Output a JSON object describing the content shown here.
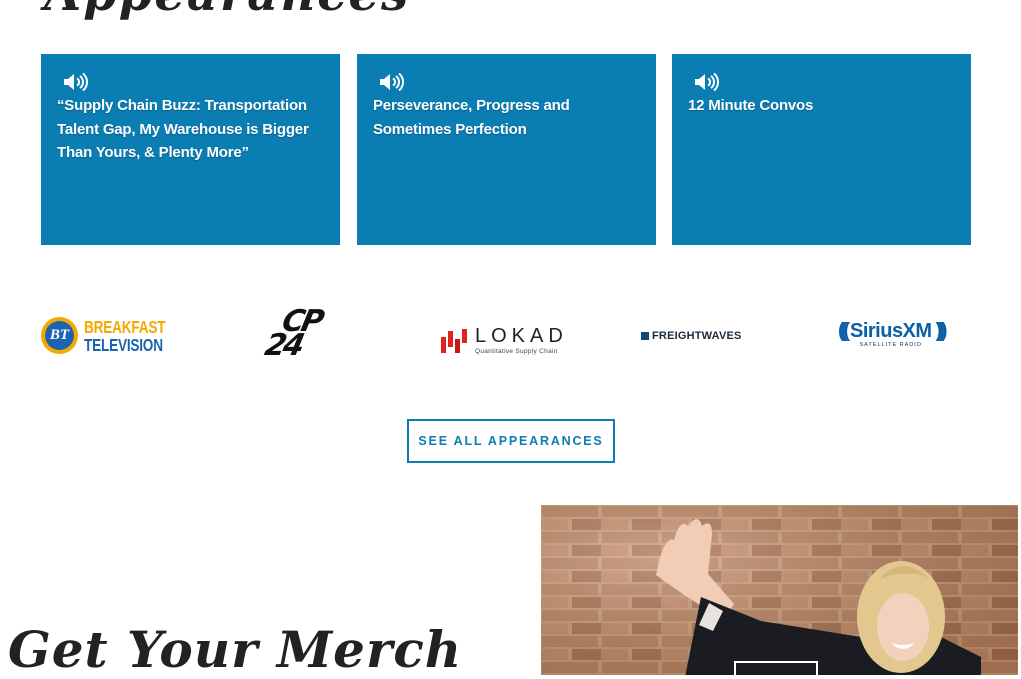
{
  "section": {
    "heading": "Appearances"
  },
  "appearances": [
    {
      "title": "“Supply Chain Buzz: Transportation Talent Gap, My Warehouse is Bigger Than Yours, & Plenty More”"
    },
    {
      "title": "Perseverance, Progress and Sometimes Perfection"
    },
    {
      "title": "12 Minute Convos"
    }
  ],
  "logos": {
    "bt": {
      "badge": "BT",
      "line1": "BREAKFAST",
      "line2": "TELEVISION"
    },
    "cp24": {
      "line1": "CP",
      "line2": "24"
    },
    "lokad": {
      "name": "LOKAD",
      "tagline": "Quantitative Supply Chain"
    },
    "freightwaves": {
      "name": "FREIGHTWAVES"
    },
    "siriusxm": {
      "name": "SiriusXM",
      "tagline": "SATELLITE RADIO"
    }
  },
  "cta": {
    "see_all_label": "SEE ALL APPEARANCES"
  },
  "merch": {
    "heading": "Get Your Merch"
  },
  "colors": {
    "accent": "#0a7db3",
    "bt_gold": "#f5a800",
    "bt_blue": "#1b64b0",
    "lokad_red": "#e2231a",
    "sirius_blue": "#0b5ea8"
  }
}
